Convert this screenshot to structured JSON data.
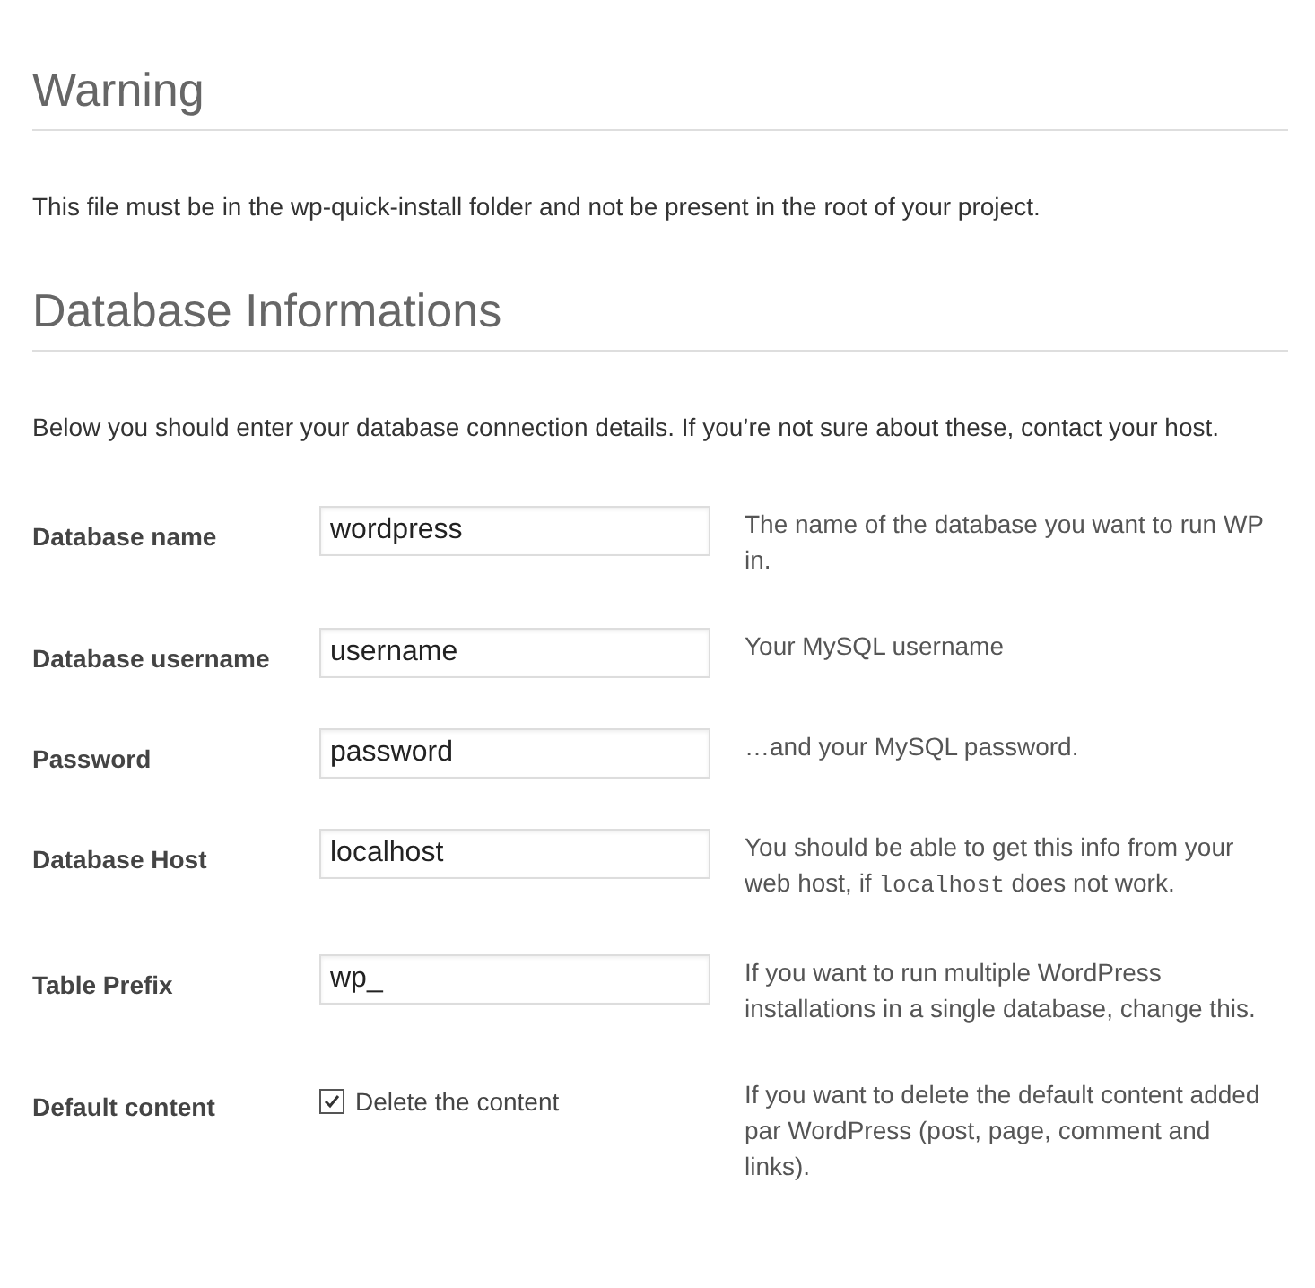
{
  "warning": {
    "title": "Warning",
    "text": "This file must be in the wp-quick-install folder and not be present in the root of your project."
  },
  "database": {
    "title": "Database Informations",
    "intro": "Below you should enter your database connection details. If you’re not sure about these, contact your host.",
    "fields": [
      {
        "kind": "input",
        "label": "Database name",
        "value": "wordpress",
        "help": [
          {
            "kind": "text",
            "text": "The name of the database you want to run WP in."
          }
        ]
      },
      {
        "kind": "input",
        "label": "Database username",
        "value": "username",
        "help": [
          {
            "kind": "text",
            "text": "Your MySQL username"
          }
        ]
      },
      {
        "kind": "input",
        "label": "Password",
        "value": "password",
        "help": [
          {
            "kind": "text",
            "text": "…and your MySQL password."
          }
        ]
      },
      {
        "kind": "input",
        "label": "Database Host",
        "value": "localhost",
        "help": [
          {
            "kind": "text",
            "text": "You should be able to get this info from your web host, if "
          },
          {
            "kind": "code",
            "text": "localhost"
          },
          {
            "kind": "text",
            "text": " does not work."
          }
        ]
      },
      {
        "kind": "input",
        "label": "Table Prefix",
        "value": "wp_",
        "help": [
          {
            "kind": "text",
            "text": "If you want to run multiple WordPress installations in a single database, change this."
          }
        ]
      },
      {
        "kind": "checkbox",
        "label": "Default content",
        "option": "Delete the content",
        "checked": true,
        "help": [
          {
            "kind": "text",
            "text": "If you want to delete the default content added par WordPress (post, page, comment and links)."
          }
        ]
      }
    ]
  }
}
